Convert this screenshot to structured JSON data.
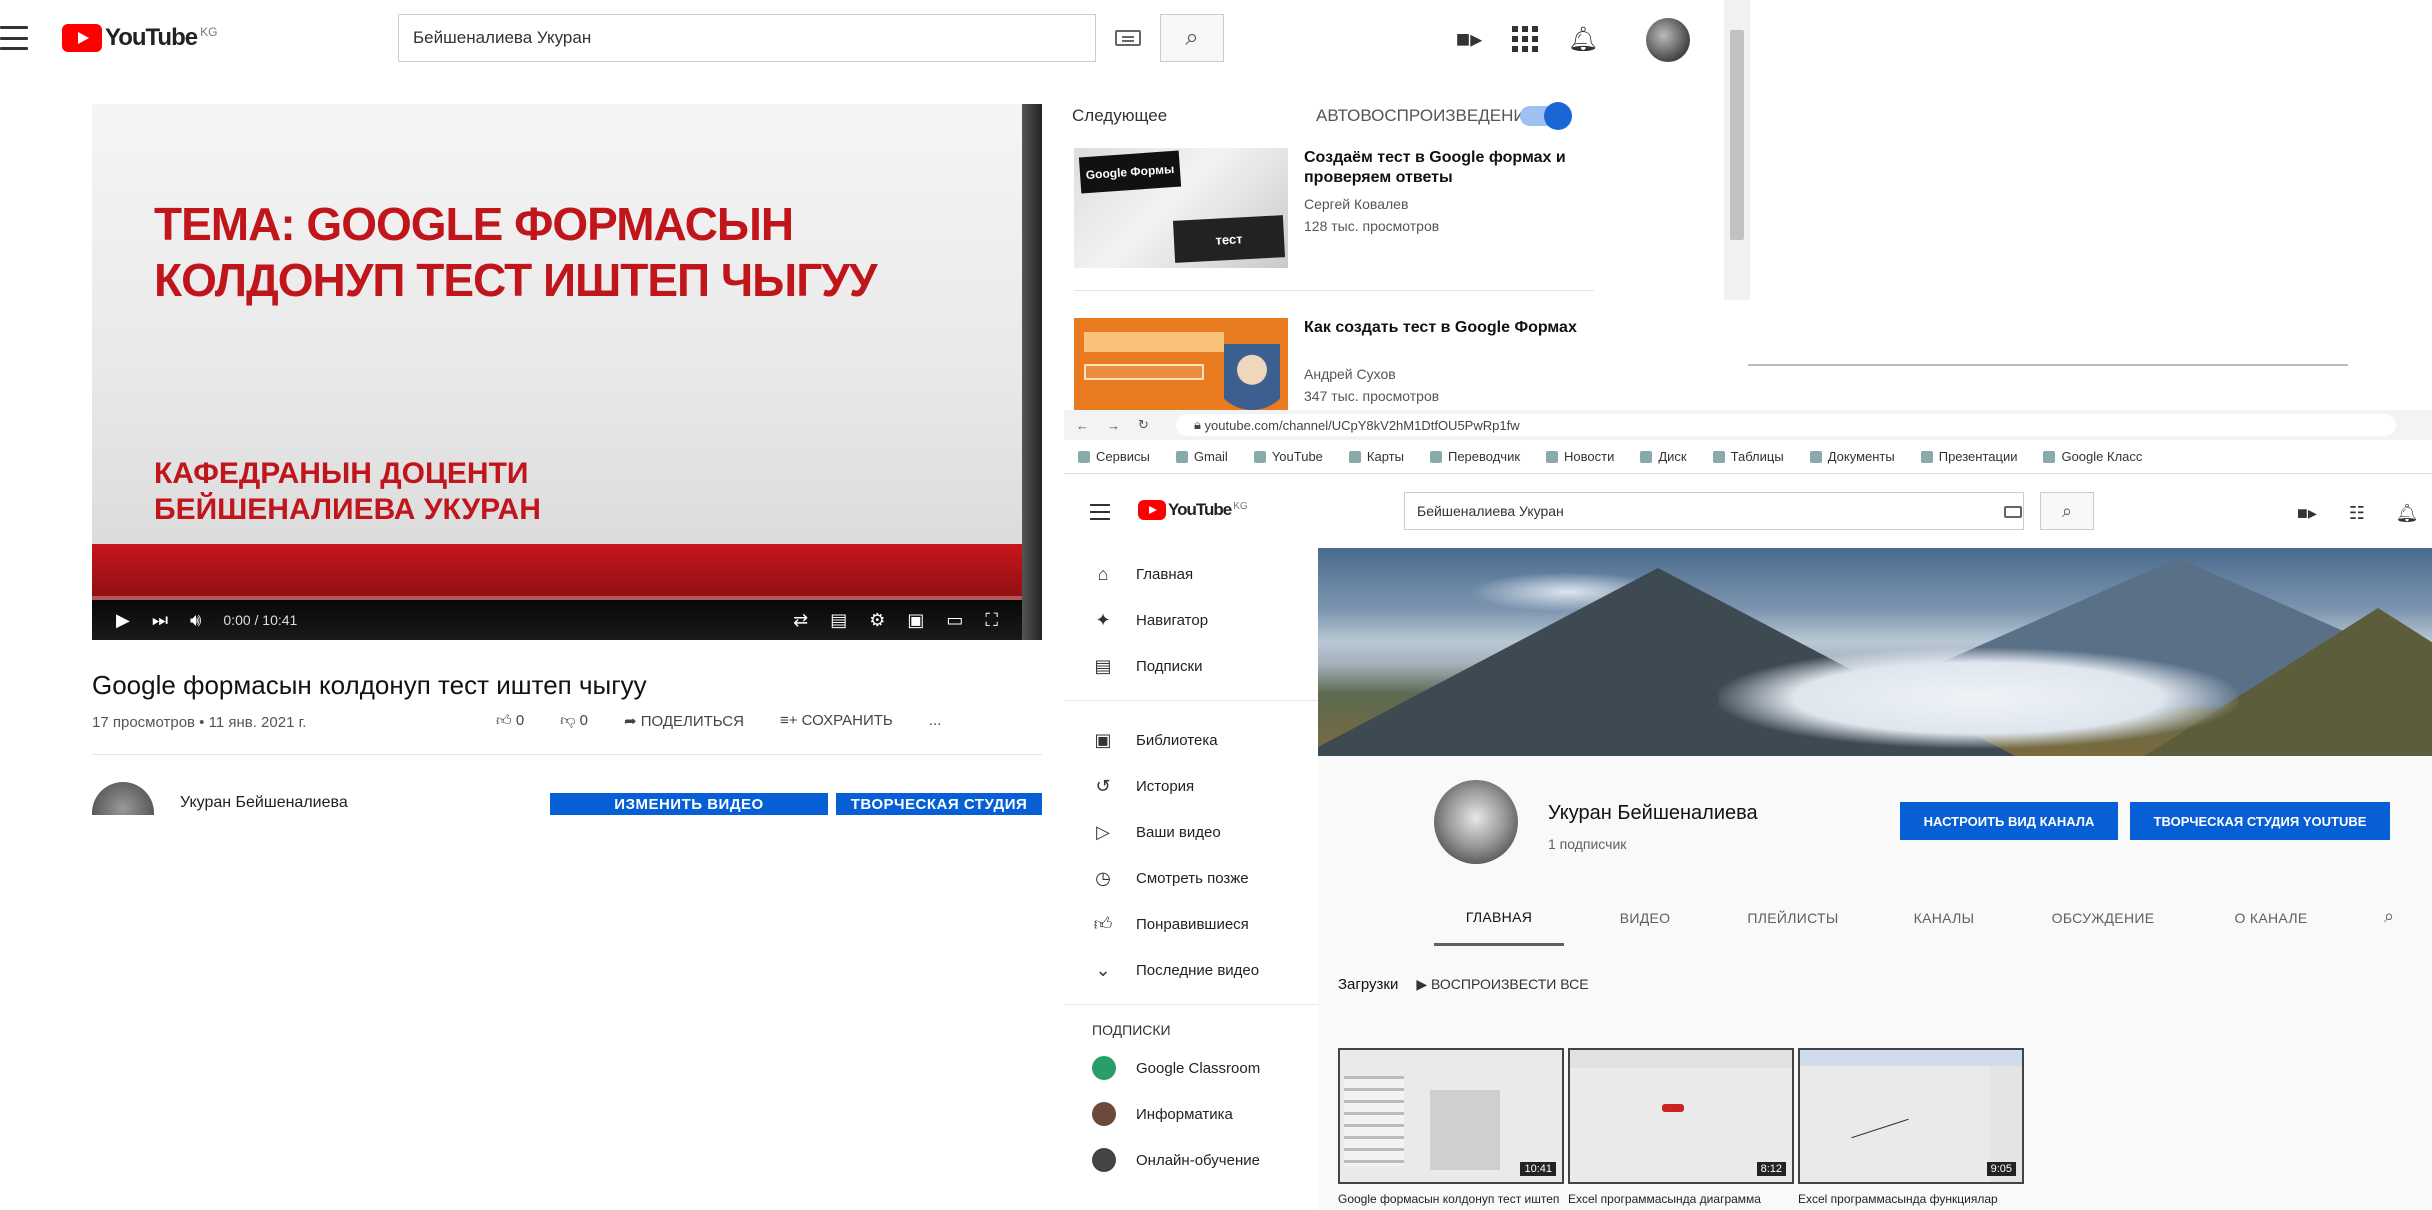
{
  "watch": {
    "logo_text": "YouTube",
    "logo_country": "KG",
    "search_value": "Бейшеналиева Укуран",
    "slide_title": "ТЕМА: GOOGLE ФОРМАСЫН КОЛДОНУП ТЕСТ ИШТЕП ЧЫГУУ",
    "slide_author_line1": "КАФЕДРАНЫН ДОЦЕНТИ",
    "slide_author_line2": "БЕЙШЕНАЛИЕВА УКУРАН",
    "time": "0:00 / 10:41",
    "progress": 0.0,
    "video_title": "Google формасын колдонуп тест иштеп чыгуу",
    "video_meta": "17 просмотров • 11 янв. 2021 г.",
    "actions": {
      "like": "0",
      "dislike": "0",
      "share": "ПОДЕЛИТЬСЯ",
      "save": "СОХРАНИТЬ",
      "more": "..."
    },
    "channel_name": "Укуран Бейшеналиева",
    "btn_left": "ИЗМЕНИТЬ ВИДЕО",
    "btn_right": "ТВОРЧЕСКАЯ СТУДИЯ",
    "next_heading": "Следующее",
    "autoplay_label": "АВТОВОСПРОИЗВЕДЕНИЕ",
    "recs": [
      {
        "title": "Создаём тест в Google формах и проверяем ответы",
        "channel": "Сергей Ковалев",
        "views": "128 тыс. просмотров",
        "thumb_text_1": "Google Формы",
        "thumb_text_2": "тест"
      },
      {
        "title": "Как создать тест в Google Формах",
        "channel": "Андрей Сухов",
        "views": "347 тыс. просмотров"
      }
    ]
  },
  "channel_window": {
    "url": "youtube.com/channel/UCpY8kV2hM1DtfOU5PwRp1fw",
    "bookmarks": [
      "Сервисы",
      "Gmail",
      "YouTube",
      "Карты",
      "Переводчик",
      "Новости",
      "Диск",
      "Таблицы",
      "Документы",
      "Презентации",
      "Google Класс"
    ],
    "logo_text": "YouTube",
    "logo_country": "KG",
    "search_value": "Бейшеналиева Укуран",
    "sidebar": {
      "items": [
        "Главная",
        "Навигатор",
        "Подписки",
        "Библиотека",
        "История",
        "Ваши видео",
        "Смотреть позже",
        "Понравившиеся",
        "Последние видео"
      ],
      "subs_heading": "ПОДПИСКИ",
      "subs": [
        "Google Classroom",
        "Информатика",
        "Онлайн-обучение"
      ]
    },
    "channel_name": "Укуран Бейшеналиева",
    "subscribers": "1 подписчик",
    "btn_customize": "НАСТРОИТЬ ВИД КАНАЛА",
    "btn_studio": "ТВОРЧЕСКАЯ СТУДИЯ YOUTUBE",
    "tabs": [
      "ГЛАВНАЯ",
      "ВИДЕО",
      "ПЛЕЙЛИСТЫ",
      "КАНАЛЫ",
      "ОБСУЖДЕНИЕ",
      "О КАНАЛЕ"
    ],
    "shelf_title": "Загрузки",
    "play_all": "ВОСПРОИЗВЕСТИ ВСЕ",
    "videos": [
      {
        "title": "Google формасын колдонуп тест иштеп чыгуу",
        "duration": "10:41"
      },
      {
        "title": "Excel программасында диаграмма",
        "duration": "8:12"
      },
      {
        "title": "Excel программасында функциялар",
        "duration": "9:05"
      }
    ]
  },
  "colors": {
    "brand_red": "#ff0000",
    "slide_red": "#c0151b",
    "action_blue": "#065fd4"
  }
}
